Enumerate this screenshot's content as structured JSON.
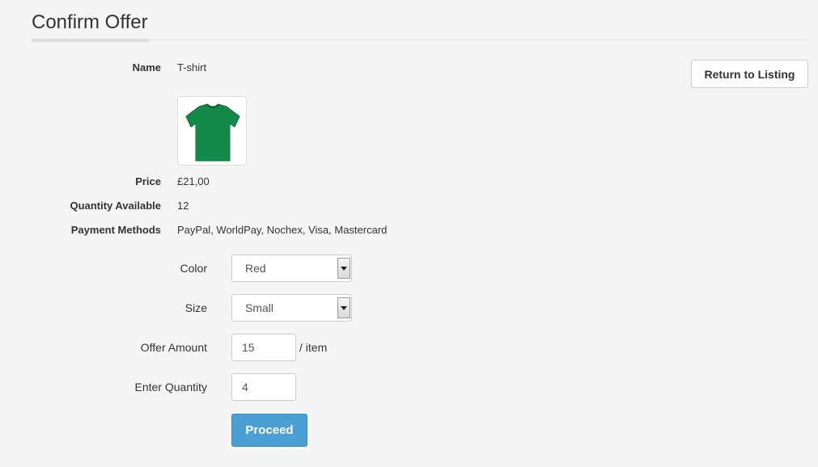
{
  "page": {
    "title": "Confirm Offer"
  },
  "actions": {
    "return_label": "Return to Listing",
    "proceed_label": "Proceed"
  },
  "product": {
    "name_label": "Name",
    "name": "T-shirt",
    "image_icon": "green-tshirt-image",
    "image_color": "#138a4a",
    "price_label": "Price",
    "price": "£21,00",
    "quantity_label": "Quantity Available",
    "quantity": "12",
    "payment_label": "Payment Methods",
    "payment": "PayPal, WorldPay, Nochex, Visa, Mastercard"
  },
  "form": {
    "color_label": "Color",
    "color_value": "Red",
    "size_label": "Size",
    "size_value": "Small",
    "offer_label": "Offer Amount",
    "offer_value": "15",
    "offer_unit": "/ item",
    "qty_label": "Enter Quantity",
    "qty_value": "4"
  },
  "colors": {
    "primary": "#4a9fd4",
    "background": "#f5f5f5",
    "text": "#333333"
  }
}
